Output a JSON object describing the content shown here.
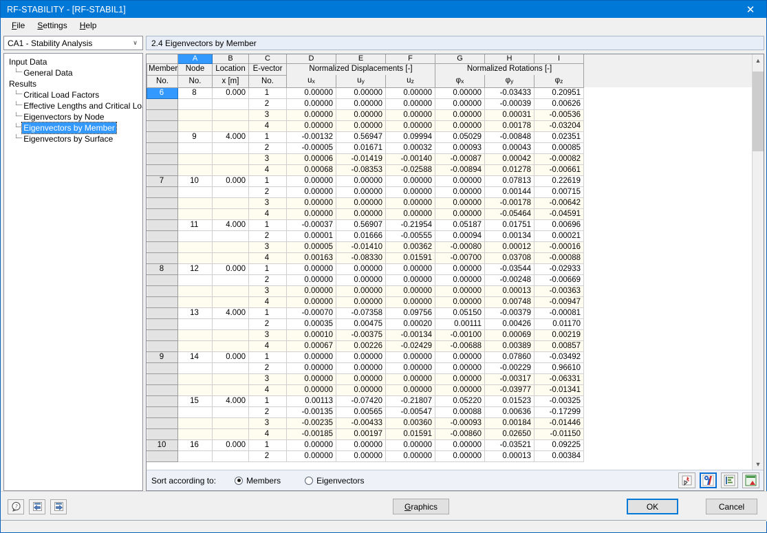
{
  "window": {
    "title": "RF-STABILITY - [RF-STABIL1]",
    "close_label": "✕"
  },
  "menu": {
    "items": [
      {
        "label": "File",
        "accel": "F"
      },
      {
        "label": "Settings",
        "accel": "S"
      },
      {
        "label": "Help",
        "accel": "H"
      }
    ]
  },
  "sidebar": {
    "combo": {
      "value": "CA1 - Stability Analysis",
      "arrow": "∨"
    },
    "tree": [
      {
        "label": "Input Data",
        "level": "root",
        "selected": false
      },
      {
        "label": "General Data",
        "level": "child",
        "selected": false
      },
      {
        "label": "Results",
        "level": "root",
        "selected": false
      },
      {
        "label": "Critical Load Factors",
        "level": "child",
        "selected": false
      },
      {
        "label": "Effective Lengths and Critical Loads",
        "level": "child",
        "selected": false
      },
      {
        "label": "Eigenvectors by Node",
        "level": "child",
        "selected": false
      },
      {
        "label": "Eigenvectors by Member",
        "level": "child",
        "selected": true
      },
      {
        "label": "Eigenvectors by Surface",
        "level": "child",
        "selected": false
      }
    ]
  },
  "panel": {
    "header": "2.4 Eigenvectors by Member"
  },
  "table": {
    "column_letters": [
      "A",
      "B",
      "C",
      "D",
      "E",
      "F",
      "G",
      "H",
      "I"
    ],
    "active_letter": "A",
    "group_headers": [
      {
        "label": "Normalized Displacements [-]",
        "span": 3
      },
      {
        "label": "Normalized Rotations [-]",
        "span": 3
      }
    ],
    "headers": [
      {
        "line1": "Member",
        "line2": "No."
      },
      {
        "line1": "Node",
        "line2": "No."
      },
      {
        "line1": "Location",
        "line2": "x [m]"
      },
      {
        "line1": "E-vector",
        "line2": "No."
      },
      {
        "line1": "",
        "line2": "u",
        "sub": "x"
      },
      {
        "line1": "",
        "line2": "u",
        "sub": "y"
      },
      {
        "line1": "",
        "line2": "u",
        "sub": "z"
      },
      {
        "line1": "",
        "line2": "φ",
        "sub": "x"
      },
      {
        "line1": "",
        "line2": "φ",
        "sub": "y"
      },
      {
        "line1": "",
        "line2": "φ",
        "sub": "z"
      }
    ],
    "rows": [
      {
        "member": "6",
        "selected": true,
        "node": "8",
        "loc": "0.000",
        "ev": "1",
        "ux": "0.00000",
        "uy": "0.00000",
        "uz": "0.00000",
        "px": "0.00000",
        "py": "-0.03433",
        "pz": "0.20951"
      },
      {
        "member": "",
        "node": "",
        "loc": "",
        "ev": "2",
        "ux": "0.00000",
        "uy": "0.00000",
        "uz": "0.00000",
        "px": "0.00000",
        "py": "-0.00039",
        "pz": "0.00626"
      },
      {
        "member": "",
        "node": "",
        "loc": "",
        "ev": "3",
        "ux": "0.00000",
        "uy": "0.00000",
        "uz": "0.00000",
        "px": "0.00000",
        "py": "0.00031",
        "pz": "-0.00536"
      },
      {
        "member": "",
        "node": "",
        "loc": "",
        "ev": "4",
        "ux": "0.00000",
        "uy": "0.00000",
        "uz": "0.00000",
        "px": "0.00000",
        "py": "0.00178",
        "pz": "-0.03204"
      },
      {
        "member": "",
        "node": "9",
        "loc": "4.000",
        "ev": "1",
        "ux": "-0.00132",
        "uy": "0.56947",
        "uz": "0.09994",
        "px": "0.05029",
        "py": "-0.00848",
        "pz": "0.02351"
      },
      {
        "member": "",
        "node": "",
        "loc": "",
        "ev": "2",
        "ux": "-0.00005",
        "uy": "0.01671",
        "uz": "0.00032",
        "px": "0.00093",
        "py": "0.00043",
        "pz": "0.00085"
      },
      {
        "member": "",
        "node": "",
        "loc": "",
        "ev": "3",
        "ux": "0.00006",
        "uy": "-0.01419",
        "uz": "-0.00140",
        "px": "-0.00087",
        "py": "0.00042",
        "pz": "-0.00082"
      },
      {
        "member": "",
        "node": "",
        "loc": "",
        "ev": "4",
        "ux": "0.00068",
        "uy": "-0.08353",
        "uz": "-0.02588",
        "px": "-0.00894",
        "py": "0.01278",
        "pz": "-0.00661"
      },
      {
        "member": "7",
        "node": "10",
        "loc": "0.000",
        "ev": "1",
        "ux": "0.00000",
        "uy": "0.00000",
        "uz": "0.00000",
        "px": "0.00000",
        "py": "0.07813",
        "pz": "0.22619"
      },
      {
        "member": "",
        "node": "",
        "loc": "",
        "ev": "2",
        "ux": "0.00000",
        "uy": "0.00000",
        "uz": "0.00000",
        "px": "0.00000",
        "py": "0.00144",
        "pz": "0.00715"
      },
      {
        "member": "",
        "node": "",
        "loc": "",
        "ev": "3",
        "ux": "0.00000",
        "uy": "0.00000",
        "uz": "0.00000",
        "px": "0.00000",
        "py": "-0.00178",
        "pz": "-0.00642"
      },
      {
        "member": "",
        "node": "",
        "loc": "",
        "ev": "4",
        "ux": "0.00000",
        "uy": "0.00000",
        "uz": "0.00000",
        "px": "0.00000",
        "py": "-0.05464",
        "pz": "-0.04591"
      },
      {
        "member": "",
        "node": "11",
        "loc": "4.000",
        "ev": "1",
        "ux": "-0.00037",
        "uy": "0.56907",
        "uz": "-0.21954",
        "px": "0.05187",
        "py": "0.01751",
        "pz": "0.00696"
      },
      {
        "member": "",
        "node": "",
        "loc": "",
        "ev": "2",
        "ux": "0.00001",
        "uy": "0.01666",
        "uz": "-0.00555",
        "px": "0.00094",
        "py": "0.00134",
        "pz": "0.00021"
      },
      {
        "member": "",
        "node": "",
        "loc": "",
        "ev": "3",
        "ux": "0.00005",
        "uy": "-0.01410",
        "uz": "0.00362",
        "px": "-0.00080",
        "py": "0.00012",
        "pz": "-0.00016"
      },
      {
        "member": "",
        "node": "",
        "loc": "",
        "ev": "4",
        "ux": "0.00163",
        "uy": "-0.08330",
        "uz": "0.01591",
        "px": "-0.00700",
        "py": "0.03708",
        "pz": "-0.00088"
      },
      {
        "member": "8",
        "node": "12",
        "loc": "0.000",
        "ev": "1",
        "ux": "0.00000",
        "uy": "0.00000",
        "uz": "0.00000",
        "px": "0.00000",
        "py": "-0.03544",
        "pz": "-0.02933"
      },
      {
        "member": "",
        "node": "",
        "loc": "",
        "ev": "2",
        "ux": "0.00000",
        "uy": "0.00000",
        "uz": "0.00000",
        "px": "0.00000",
        "py": "-0.00248",
        "pz": "-0.00669"
      },
      {
        "member": "",
        "node": "",
        "loc": "",
        "ev": "3",
        "ux": "0.00000",
        "uy": "0.00000",
        "uz": "0.00000",
        "px": "0.00000",
        "py": "0.00013",
        "pz": "-0.00363"
      },
      {
        "member": "",
        "node": "",
        "loc": "",
        "ev": "4",
        "ux": "0.00000",
        "uy": "0.00000",
        "uz": "0.00000",
        "px": "0.00000",
        "py": "0.00748",
        "pz": "-0.00947"
      },
      {
        "member": "",
        "node": "13",
        "loc": "4.000",
        "ev": "1",
        "ux": "-0.00070",
        "uy": "-0.07358",
        "uz": "0.09756",
        "px": "0.05150",
        "py": "-0.00379",
        "pz": "-0.00081"
      },
      {
        "member": "",
        "node": "",
        "loc": "",
        "ev": "2",
        "ux": "0.00035",
        "uy": "0.00475",
        "uz": "0.00020",
        "px": "0.00111",
        "py": "0.00426",
        "pz": "0.01170"
      },
      {
        "member": "",
        "node": "",
        "loc": "",
        "ev": "3",
        "ux": "0.00010",
        "uy": "-0.00375",
        "uz": "-0.00134",
        "px": "-0.00100",
        "py": "0.00069",
        "pz": "0.00219"
      },
      {
        "member": "",
        "node": "",
        "loc": "",
        "ev": "4",
        "ux": "0.00067",
        "uy": "0.00226",
        "uz": "-0.02429",
        "px": "-0.00688",
        "py": "0.00389",
        "pz": "0.00857"
      },
      {
        "member": "9",
        "node": "14",
        "loc": "0.000",
        "ev": "1",
        "ux": "0.00000",
        "uy": "0.00000",
        "uz": "0.00000",
        "px": "0.00000",
        "py": "0.07860",
        "pz": "-0.03492"
      },
      {
        "member": "",
        "node": "",
        "loc": "",
        "ev": "2",
        "ux": "0.00000",
        "uy": "0.00000",
        "uz": "0.00000",
        "px": "0.00000",
        "py": "-0.00229",
        "pz": "0.96610"
      },
      {
        "member": "",
        "node": "",
        "loc": "",
        "ev": "3",
        "ux": "0.00000",
        "uy": "0.00000",
        "uz": "0.00000",
        "px": "0.00000",
        "py": "-0.00317",
        "pz": "-0.06331"
      },
      {
        "member": "",
        "node": "",
        "loc": "",
        "ev": "4",
        "ux": "0.00000",
        "uy": "0.00000",
        "uz": "0.00000",
        "px": "0.00000",
        "py": "-0.03977",
        "pz": "-0.01341"
      },
      {
        "member": "",
        "node": "15",
        "loc": "4.000",
        "ev": "1",
        "ux": "0.00113",
        "uy": "-0.07420",
        "uz": "-0.21807",
        "px": "0.05220",
        "py": "0.01523",
        "pz": "-0.00325"
      },
      {
        "member": "",
        "node": "",
        "loc": "",
        "ev": "2",
        "ux": "-0.00135",
        "uy": "0.00565",
        "uz": "-0.00547",
        "px": "0.00088",
        "py": "0.00636",
        "pz": "-0.17299"
      },
      {
        "member": "",
        "node": "",
        "loc": "",
        "ev": "3",
        "ux": "-0.00235",
        "uy": "-0.00433",
        "uz": "0.00360",
        "px": "-0.00093",
        "py": "0.00184",
        "pz": "-0.01446"
      },
      {
        "member": "",
        "node": "",
        "loc": "",
        "ev": "4",
        "ux": "-0.00185",
        "uy": "0.00197",
        "uz": "0.01591",
        "px": "-0.00860",
        "py": "0.02650",
        "pz": "-0.01150"
      },
      {
        "member": "10",
        "node": "16",
        "loc": "0.000",
        "ev": "1",
        "ux": "0.00000",
        "uy": "0.00000",
        "uz": "0.00000",
        "px": "0.00000",
        "py": "-0.03521",
        "pz": "0.09225"
      },
      {
        "member": "",
        "node": "",
        "loc": "",
        "ev": "2",
        "ux": "0.00000",
        "uy": "0.00000",
        "uz": "0.00000",
        "px": "0.00000",
        "py": "0.00013",
        "pz": "0.00384"
      }
    ]
  },
  "sort": {
    "label": "Sort according to:",
    "options": [
      {
        "label": "Members",
        "selected": true
      },
      {
        "label": "Eigenvectors",
        "selected": false
      }
    ]
  },
  "grid_toolbar": {
    "buttons": [
      {
        "name": "pin-selection-icon",
        "selected": false
      },
      {
        "name": "view-mode-icon",
        "selected": true
      },
      {
        "name": "table-filter-icon",
        "selected": false
      },
      {
        "name": "export-excel-icon",
        "selected": false
      }
    ]
  },
  "footer": {
    "help_label": "?",
    "prev_label": "⇦",
    "next_label": "⇨",
    "graphics": "Graphics",
    "graphics_accel": "G",
    "ok": "OK",
    "cancel": "Cancel"
  },
  "colors": {
    "title_bar": "#0078d7",
    "accent": "#3399ff",
    "row_stripe": "#fffdf0",
    "header_gray": "#f0f0f0"
  }
}
